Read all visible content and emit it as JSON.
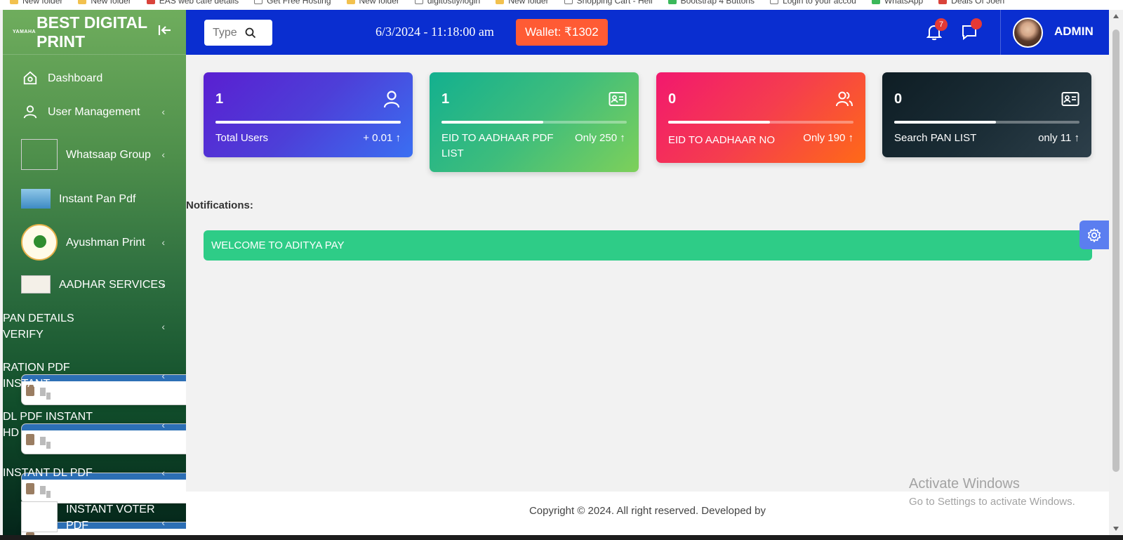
{
  "browser": {
    "bookmarks": [
      "New folder",
      "New folder",
      "EAS web cafe details",
      "Get Free Hosting",
      "New folder",
      "digitostly/login",
      "New folder",
      "Shopping Cart - Hell",
      "Bootstrap 4 Buttons",
      "Login to your accou",
      "WhatsApp",
      "Deals Of Joeh"
    ]
  },
  "sidebar": {
    "logo_text": "YAMAHA",
    "brand_name": "BEST DIGITAL PRINT",
    "items": [
      {
        "label": "Dashboard",
        "has_chevron": false
      },
      {
        "label": "User Management",
        "has_chevron": true
      },
      {
        "label": "Whatsaap Group",
        "has_chevron": true
      },
      {
        "label": "Instant Pan Pdf",
        "has_chevron": false
      },
      {
        "label": "Ayushman Print",
        "has_chevron": true
      },
      {
        "label": "AADHAR SERVICES",
        "has_chevron": true
      },
      {
        "label": "PAN DETAILS VERIFY",
        "has_chevron": true
      },
      {
        "label": "RATION PDF INSTANT",
        "has_chevron": true
      },
      {
        "label": "DL PDF INSTANT HD",
        "has_chevron": true
      },
      {
        "label": "INSTANT DL PDF",
        "has_chevron": true
      },
      {
        "label": "INSTANT VOTER PDF",
        "has_chevron": true
      }
    ],
    "chevron_glyph": "‹"
  },
  "topbar": {
    "search_placeholder": "Type t",
    "datetime": "6/3/2024 - 11:18:00 am",
    "wallet": "Wallet: ₹1302",
    "notification_count": "7",
    "user_name": "ADMIN"
  },
  "cards": [
    {
      "number": "1",
      "label": "Total Users",
      "meta": "+ 0.01 ↑",
      "progress": 1.0,
      "icon": "user-icon"
    },
    {
      "number": "1",
      "label": "EID TO AADHAAR PDF LIST",
      "meta": "Only 250 ↑",
      "progress": 0.55,
      "icon": "id-card-icon"
    },
    {
      "number": "0",
      "label": "EID TO AADHAAR NO",
      "meta": "Only 190 ↑",
      "progress": 0.55,
      "icon": "users-icon"
    },
    {
      "number": "0",
      "label": "Search PAN LIST",
      "meta": "only 11 ↑",
      "progress": 0.55,
      "icon": "id-card-icon"
    }
  ],
  "notifications": {
    "title": "Notifications:",
    "message": "WELCOME TO ADITYA PAY"
  },
  "footer": {
    "text": "Copyright © 2024. All right reserved. Developed by"
  },
  "watermark": {
    "line1": "Activate Windows",
    "line2": "Go to Settings to activate Windows."
  },
  "colors": {
    "topbar": "#0a2ed0",
    "wallet": "#ff5b34",
    "notification_bar": "#2ecc87",
    "gear_tab": "#5b7ef0"
  }
}
